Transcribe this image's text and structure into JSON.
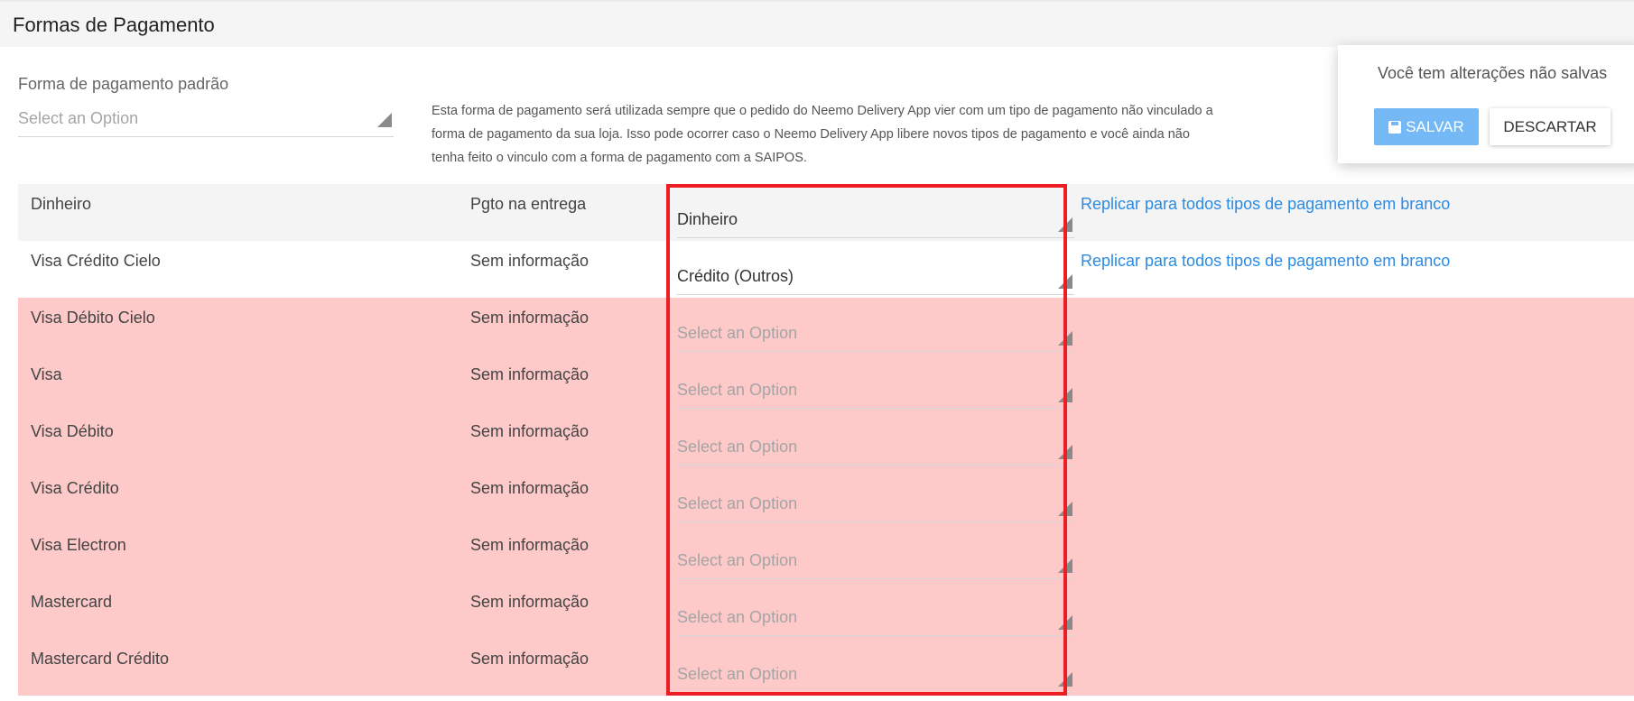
{
  "header": {
    "title": "Formas de Pagamento"
  },
  "default_payment": {
    "label": "Forma de pagamento padrão",
    "placeholder": "Select an Option"
  },
  "info_text": "Esta forma de pagamento será utilizada sempre que o pedido do Neemo Delivery App vier com um tipo de pagamento não vinculado a forma de pagamento da sua loja. Isso pode ocorrer caso o Neemo Delivery App libere novos tipos de pagamento e você ainda não tenha feito o vinculo com a forma de pagamento com a SAIPOS.",
  "unsaved": {
    "message": "Você tem alterações não salvas",
    "save_label": "SALVAR",
    "discard_label": "DESCARTAR"
  },
  "replicate_label": "Replicar para todos tipos de pagamento em branco",
  "rows": [
    {
      "name": "Dinheiro",
      "type": "Pgto na entrega",
      "selected": "Dinheiro",
      "placeholder": "Select an Option",
      "replicate": "Replicar para todos tipos de pagamento em branco"
    },
    {
      "name": "Visa Crédito Cielo",
      "type": "Sem informação",
      "selected": "Crédito (Outros)",
      "placeholder": "Select an Option",
      "replicate": "Replicar para todos tipos de pagamento em branco"
    },
    {
      "name": "Visa Débito Cielo",
      "type": "Sem informação",
      "selected": "",
      "placeholder": "Select an Option"
    },
    {
      "name": "Visa",
      "type": "Sem informação",
      "selected": "",
      "placeholder": "Select an Option"
    },
    {
      "name": "Visa Débito",
      "type": "Sem informação",
      "selected": "",
      "placeholder": "Select an Option"
    },
    {
      "name": "Visa Crédito",
      "type": "Sem informação",
      "selected": "",
      "placeholder": "Select an Option"
    },
    {
      "name": "Visa Electron",
      "type": "Sem informação",
      "selected": "",
      "placeholder": "Select an Option"
    },
    {
      "name": "Mastercard",
      "type": "Sem informação",
      "selected": "",
      "placeholder": "Select an Option"
    },
    {
      "name": "Mastercard Crédito",
      "type": "Sem informação",
      "selected": "",
      "placeholder": "Select an Option"
    }
  ],
  "colors": {
    "unmapped_row": "#fdc9c9",
    "link": "#2a8be6",
    "save_button": "#74b9f5",
    "highlight_border": "#ee1d23"
  }
}
